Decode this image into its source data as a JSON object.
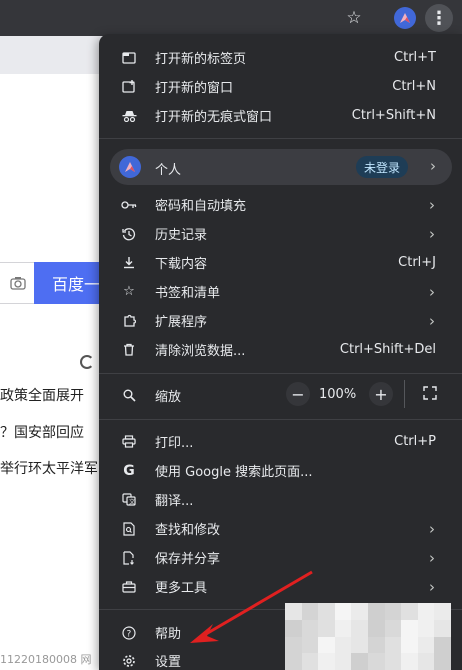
{
  "toolbar": {
    "star_icon": "star-icon",
    "profile_icon": "profile-avatar",
    "menu_icon": "more-vert-icon"
  },
  "page": {
    "search_button": "百度一下",
    "news": [
      "政策全面展开",
      "？国安部回应",
      "举行环太平洋军"
    ],
    "footer": "11220180008  网"
  },
  "menu": {
    "items_top": [
      {
        "icon": "new-tab-icon",
        "label": "打开新的标签页",
        "shortcut": "Ctrl+T"
      },
      {
        "icon": "new-window-icon",
        "label": "打开新的窗口",
        "shortcut": "Ctrl+N"
      },
      {
        "icon": "incognito-icon",
        "label": "打开新的无痕式窗口",
        "shortcut": "Ctrl+Shift+N"
      }
    ],
    "person": {
      "label": "个人",
      "badge": "未登录"
    },
    "items_mid": [
      {
        "icon": "key-icon",
        "label": "密码和自动填充",
        "shortcut": "",
        "arrow": true
      },
      {
        "icon": "history-icon",
        "label": "历史记录",
        "shortcut": "",
        "arrow": true
      },
      {
        "icon": "download-icon",
        "label": "下载内容",
        "shortcut": "Ctrl+J",
        "arrow": false
      },
      {
        "icon": "star-icon",
        "label": "书签和清单",
        "shortcut": "",
        "arrow": true
      },
      {
        "icon": "extension-icon",
        "label": "扩展程序",
        "shortcut": "",
        "arrow": true
      },
      {
        "icon": "trash-icon",
        "label": "清除浏览数据...",
        "shortcut": "Ctrl+Shift+Del",
        "arrow": false
      }
    ],
    "zoom": {
      "label": "缩放",
      "minus": "−",
      "value": "100%",
      "plus": "+"
    },
    "items_bottom": [
      {
        "icon": "print-icon",
        "label": "打印...",
        "shortcut": "Ctrl+P",
        "arrow": false
      },
      {
        "icon": "google-icon",
        "label": "使用 Google 搜索此页面...",
        "shortcut": "",
        "arrow": false
      },
      {
        "icon": "translate-icon",
        "label": "翻译...",
        "shortcut": "",
        "arrow": false
      },
      {
        "icon": "find-icon",
        "label": "查找和修改",
        "shortcut": "",
        "arrow": true
      },
      {
        "icon": "save-share-icon",
        "label": "保存并分享",
        "shortcut": "",
        "arrow": true
      },
      {
        "icon": "toolbox-icon",
        "label": "更多工具",
        "shortcut": "",
        "arrow": true
      }
    ],
    "items_last": [
      {
        "icon": "help-icon",
        "label": "帮助",
        "shortcut": "",
        "arrow": false
      },
      {
        "icon": "gear-icon",
        "label": "设置",
        "shortcut": "",
        "arrow": false
      }
    ],
    "arrow_glyph": "›"
  },
  "colors": {
    "menu_bg": "#292a2d",
    "accent": "#4e6ef2",
    "annotation_arrow": "#e02020"
  }
}
